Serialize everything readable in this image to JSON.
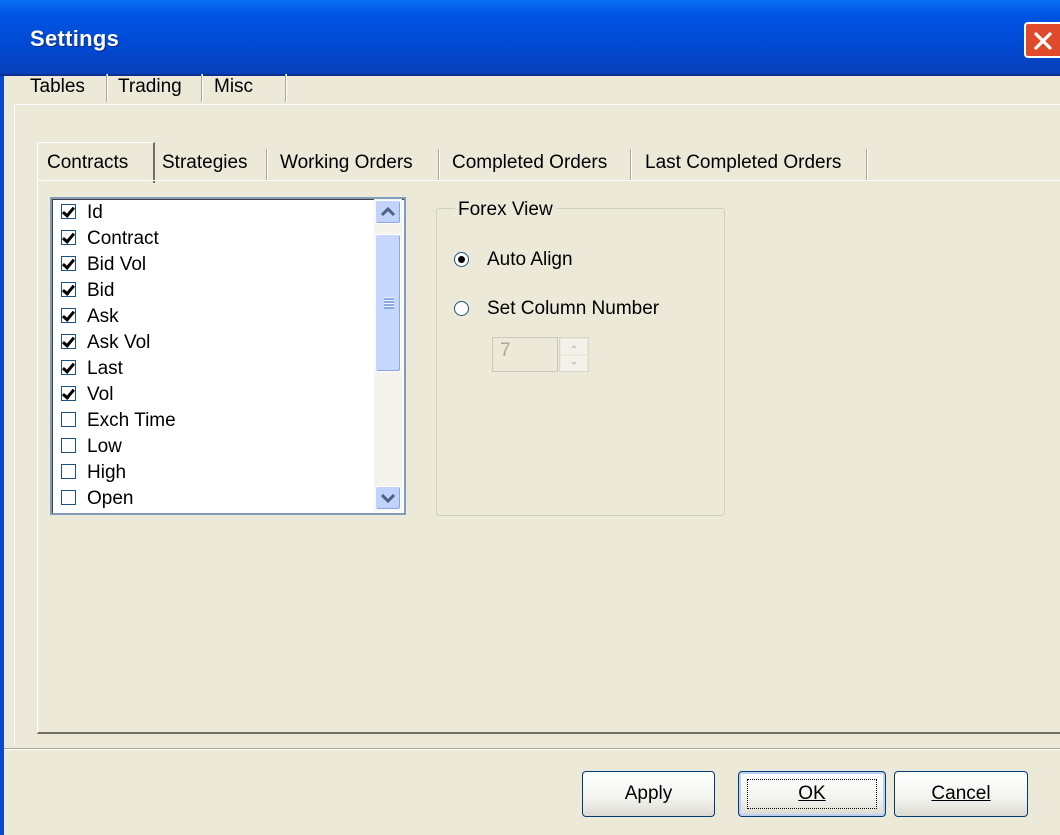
{
  "window": {
    "title": "Settings"
  },
  "outer_tabs": [
    "Tables",
    "Trading",
    "Misc"
  ],
  "inner_tabs": [
    "Contracts",
    "Strategies",
    "Working Orders",
    "Completed Orders",
    "Last Completed Orders"
  ],
  "columns_list": {
    "items": [
      {
        "label": "Id",
        "checked": true
      },
      {
        "label": "Contract",
        "checked": true
      },
      {
        "label": "Bid Vol",
        "checked": true
      },
      {
        "label": "Bid",
        "checked": true
      },
      {
        "label": "Ask",
        "checked": true
      },
      {
        "label": "Ask Vol",
        "checked": true
      },
      {
        "label": "Last",
        "checked": true
      },
      {
        "label": "Vol",
        "checked": true
      },
      {
        "label": "Exch Time",
        "checked": false
      },
      {
        "label": "Low",
        "checked": false
      },
      {
        "label": "High",
        "checked": false
      },
      {
        "label": "Open",
        "checked": false
      }
    ]
  },
  "forex_view": {
    "title": "Forex View",
    "auto_align_label": "Auto Align",
    "set_column_label": "Set Column Number",
    "selected": "auto_align",
    "column_number": "7"
  },
  "buttons": {
    "apply": "Apply",
    "ok": "OK",
    "cancel": "Cancel"
  }
}
